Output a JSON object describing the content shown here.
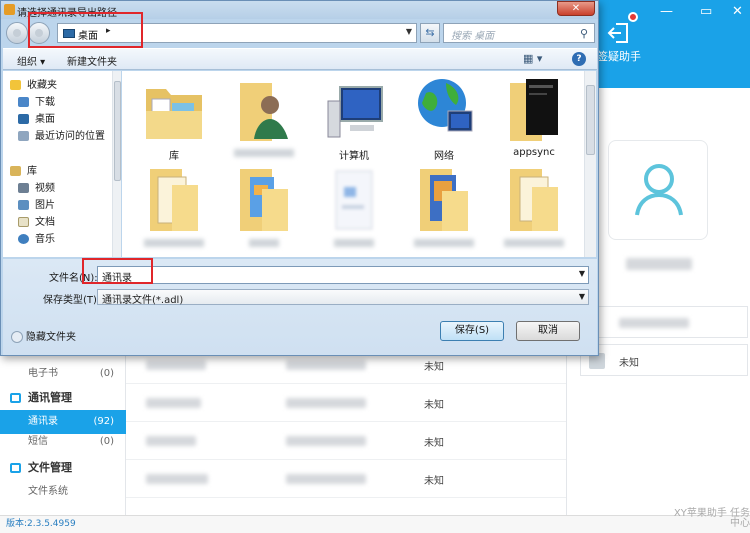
{
  "app": {
    "tool_label": "签疑助手",
    "sidebar": [
      {
        "type": "row",
        "label": "电子书",
        "count": "(0)"
      },
      {
        "type": "head",
        "label": "通讯管理"
      },
      {
        "type": "row",
        "label": "通讯录",
        "count": "(92)",
        "active": true
      },
      {
        "type": "row",
        "label": "短信",
        "count": "(0)"
      },
      {
        "type": "head",
        "label": "文件管理"
      },
      {
        "type": "row",
        "label": "文件系统",
        "count": ""
      }
    ],
    "list_status": [
      "未知",
      "未知",
      "未知",
      "未知"
    ],
    "right_field_value": "未知",
    "version": "版本:2.3.5.4959",
    "watermark": "XY苹果助手 任务中心"
  },
  "dialog": {
    "title": "请选择通讯录导出路径",
    "close_label": "✕",
    "address": {
      "location": "桌面",
      "arrow": "▸"
    },
    "search_placeholder": "搜索 桌面",
    "toolbar": {
      "organize": "组织 ▾",
      "new_folder": "新建文件夹",
      "view": "▦ ▾",
      "help": "?"
    },
    "nav_pane": [
      "收藏夹",
      "下载",
      "桌面",
      "最近访问的位置",
      "库",
      "视频",
      "图片",
      "文档",
      "音乐"
    ],
    "files": [
      {
        "name": "库"
      },
      {
        "name": ""
      },
      {
        "name": "计算机"
      },
      {
        "name": "网络"
      },
      {
        "name": "appsync"
      },
      {
        "name": ""
      },
      {
        "name": ""
      },
      {
        "name": ""
      },
      {
        "name": ""
      },
      {
        "name": ""
      }
    ],
    "filename_label": "文件名(N):",
    "filename_value": "通讯录",
    "filetype_label": "保存类型(T):",
    "filetype_value": "通讯录文件(*.adl)",
    "hide_folders": "隐藏文件夹",
    "save_button": "保存(S)",
    "cancel_button": "取消"
  },
  "colors": {
    "accent": "#1aa2e8",
    "highlight": "#e0262a",
    "dialog_frame": "#bcd5ec"
  }
}
